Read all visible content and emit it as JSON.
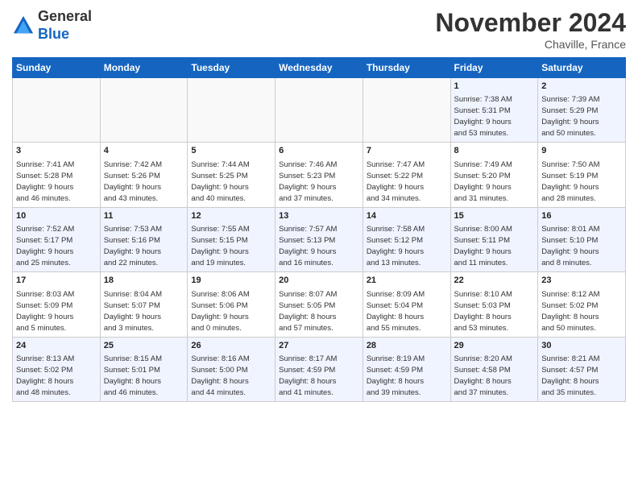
{
  "header": {
    "logo_line1": "General",
    "logo_line2": "Blue",
    "month": "November 2024",
    "location": "Chaville, France"
  },
  "weekdays": [
    "Sunday",
    "Monday",
    "Tuesday",
    "Wednesday",
    "Thursday",
    "Friday",
    "Saturday"
  ],
  "weeks": [
    [
      {
        "day": "",
        "info": ""
      },
      {
        "day": "",
        "info": ""
      },
      {
        "day": "",
        "info": ""
      },
      {
        "day": "",
        "info": ""
      },
      {
        "day": "",
        "info": ""
      },
      {
        "day": "1",
        "info": "Sunrise: 7:38 AM\nSunset: 5:31 PM\nDaylight: 9 hours\nand 53 minutes."
      },
      {
        "day": "2",
        "info": "Sunrise: 7:39 AM\nSunset: 5:29 PM\nDaylight: 9 hours\nand 50 minutes."
      }
    ],
    [
      {
        "day": "3",
        "info": "Sunrise: 7:41 AM\nSunset: 5:28 PM\nDaylight: 9 hours\nand 46 minutes."
      },
      {
        "day": "4",
        "info": "Sunrise: 7:42 AM\nSunset: 5:26 PM\nDaylight: 9 hours\nand 43 minutes."
      },
      {
        "day": "5",
        "info": "Sunrise: 7:44 AM\nSunset: 5:25 PM\nDaylight: 9 hours\nand 40 minutes."
      },
      {
        "day": "6",
        "info": "Sunrise: 7:46 AM\nSunset: 5:23 PM\nDaylight: 9 hours\nand 37 minutes."
      },
      {
        "day": "7",
        "info": "Sunrise: 7:47 AM\nSunset: 5:22 PM\nDaylight: 9 hours\nand 34 minutes."
      },
      {
        "day": "8",
        "info": "Sunrise: 7:49 AM\nSunset: 5:20 PM\nDaylight: 9 hours\nand 31 minutes."
      },
      {
        "day": "9",
        "info": "Sunrise: 7:50 AM\nSunset: 5:19 PM\nDaylight: 9 hours\nand 28 minutes."
      }
    ],
    [
      {
        "day": "10",
        "info": "Sunrise: 7:52 AM\nSunset: 5:17 PM\nDaylight: 9 hours\nand 25 minutes."
      },
      {
        "day": "11",
        "info": "Sunrise: 7:53 AM\nSunset: 5:16 PM\nDaylight: 9 hours\nand 22 minutes."
      },
      {
        "day": "12",
        "info": "Sunrise: 7:55 AM\nSunset: 5:15 PM\nDaylight: 9 hours\nand 19 minutes."
      },
      {
        "day": "13",
        "info": "Sunrise: 7:57 AM\nSunset: 5:13 PM\nDaylight: 9 hours\nand 16 minutes."
      },
      {
        "day": "14",
        "info": "Sunrise: 7:58 AM\nSunset: 5:12 PM\nDaylight: 9 hours\nand 13 minutes."
      },
      {
        "day": "15",
        "info": "Sunrise: 8:00 AM\nSunset: 5:11 PM\nDaylight: 9 hours\nand 11 minutes."
      },
      {
        "day": "16",
        "info": "Sunrise: 8:01 AM\nSunset: 5:10 PM\nDaylight: 9 hours\nand 8 minutes."
      }
    ],
    [
      {
        "day": "17",
        "info": "Sunrise: 8:03 AM\nSunset: 5:09 PM\nDaylight: 9 hours\nand 5 minutes."
      },
      {
        "day": "18",
        "info": "Sunrise: 8:04 AM\nSunset: 5:07 PM\nDaylight: 9 hours\nand 3 minutes."
      },
      {
        "day": "19",
        "info": "Sunrise: 8:06 AM\nSunset: 5:06 PM\nDaylight: 9 hours\nand 0 minutes."
      },
      {
        "day": "20",
        "info": "Sunrise: 8:07 AM\nSunset: 5:05 PM\nDaylight: 8 hours\nand 57 minutes."
      },
      {
        "day": "21",
        "info": "Sunrise: 8:09 AM\nSunset: 5:04 PM\nDaylight: 8 hours\nand 55 minutes."
      },
      {
        "day": "22",
        "info": "Sunrise: 8:10 AM\nSunset: 5:03 PM\nDaylight: 8 hours\nand 53 minutes."
      },
      {
        "day": "23",
        "info": "Sunrise: 8:12 AM\nSunset: 5:02 PM\nDaylight: 8 hours\nand 50 minutes."
      }
    ],
    [
      {
        "day": "24",
        "info": "Sunrise: 8:13 AM\nSunset: 5:02 PM\nDaylight: 8 hours\nand 48 minutes."
      },
      {
        "day": "25",
        "info": "Sunrise: 8:15 AM\nSunset: 5:01 PM\nDaylight: 8 hours\nand 46 minutes."
      },
      {
        "day": "26",
        "info": "Sunrise: 8:16 AM\nSunset: 5:00 PM\nDaylight: 8 hours\nand 44 minutes."
      },
      {
        "day": "27",
        "info": "Sunrise: 8:17 AM\nSunset: 4:59 PM\nDaylight: 8 hours\nand 41 minutes."
      },
      {
        "day": "28",
        "info": "Sunrise: 8:19 AM\nSunset: 4:59 PM\nDaylight: 8 hours\nand 39 minutes."
      },
      {
        "day": "29",
        "info": "Sunrise: 8:20 AM\nSunset: 4:58 PM\nDaylight: 8 hours\nand 37 minutes."
      },
      {
        "day": "30",
        "info": "Sunrise: 8:21 AM\nSunset: 4:57 PM\nDaylight: 8 hours\nand 35 minutes."
      }
    ]
  ]
}
